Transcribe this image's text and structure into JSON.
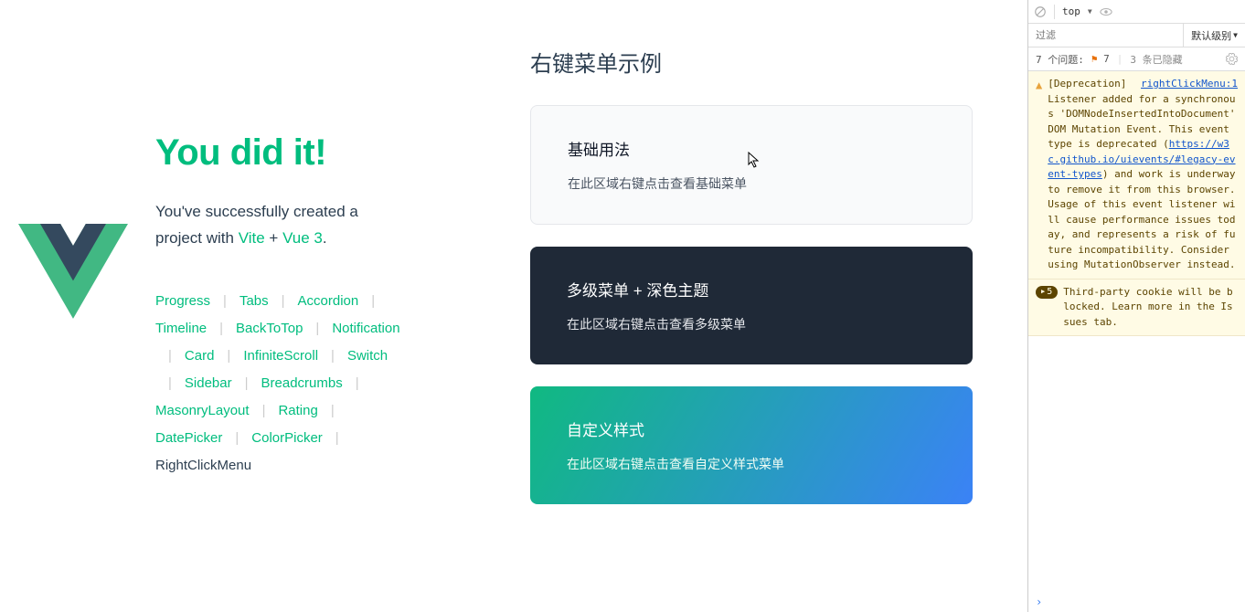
{
  "sidebar": {
    "title": "You did it!",
    "subtitle_pre": "You've successfully created a project with ",
    "tech1": "Vite",
    "plus": " + ",
    "tech2": "Vue 3",
    "period": ".",
    "links": [
      "Progress",
      "Tabs",
      "Accordion",
      "Timeline",
      "BackToTop",
      "Notification",
      "Card",
      "InfiniteScroll",
      "Switch",
      "Sidebar",
      "Breadcrumbs",
      "MasonryLayout",
      "Rating",
      "DatePicker",
      "ColorPicker",
      "RightClickMenu"
    ],
    "active_index": 15
  },
  "main": {
    "title": "右键菜单示例",
    "cards": [
      {
        "title": "基础用法",
        "desc": "在此区域右键点击查看基础菜单",
        "variant": "light"
      },
      {
        "title": "多级菜单 + 深色主题",
        "desc": "在此区域右键点击查看多级菜单",
        "variant": "dark"
      },
      {
        "title": "自定义样式",
        "desc": "在此区域右键点击查看自定义样式菜单",
        "variant": "gradient"
      }
    ]
  },
  "devtools": {
    "context": "top",
    "filter_placeholder": "过滤",
    "loglevel": "默认级别",
    "issues_label": "7 个问题:",
    "issues_count": "7",
    "hidden_label": "3 条已隐藏",
    "messages": [
      {
        "type": "warn",
        "source": "rightClickMenu:1",
        "text_pre": "[Deprecation] Listener added for a synchronous 'DOMNodeInsertedIntoDocument' DOM Mutation Event. This event type is deprecated (",
        "link": "https://w3c.github.io/uievents/#legacy-event-types",
        "text_post": ") and work is underway to remove it from this browser. Usage of this event listener will cause performance issues today, and represents a risk of future incompatibility. Consider using MutationObserver instead."
      },
      {
        "type": "warn-badge",
        "badge": "5",
        "text": "Third-party cookie will be blocked. Learn more in the Issues tab."
      }
    ]
  }
}
